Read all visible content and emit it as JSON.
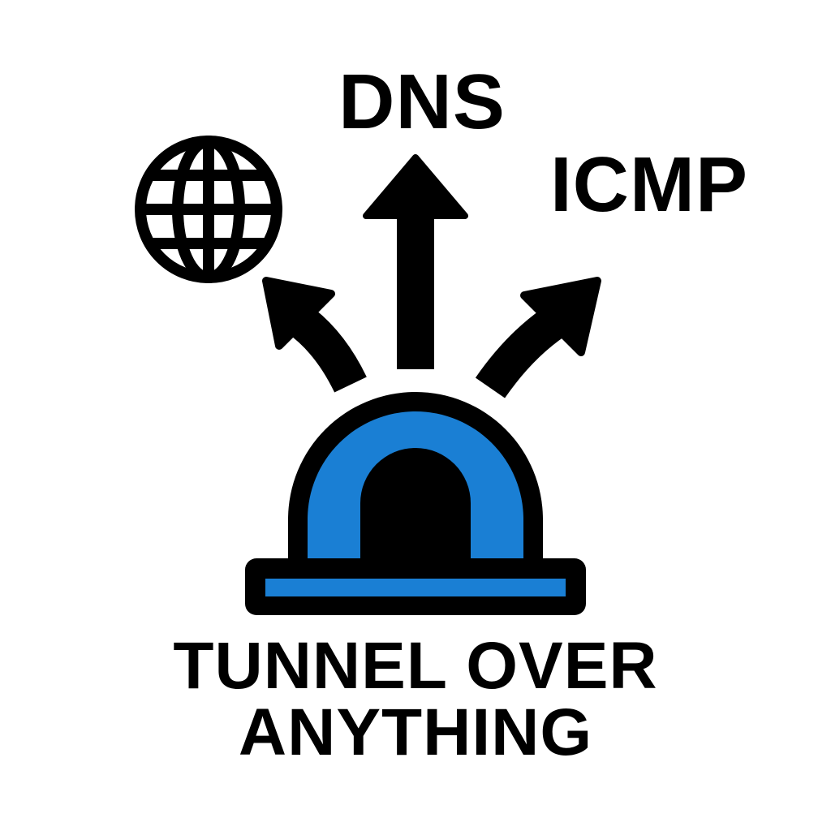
{
  "labels": {
    "top": "DNS",
    "right": "ICMP"
  },
  "caption": {
    "line1": "TUNNEL OVER",
    "line2": "ANYTHING"
  },
  "icons": {
    "globe": "globe-icon",
    "tunnel": "tunnel-icon",
    "arrows": [
      "arrow-up-left-icon",
      "arrow-up-icon",
      "arrow-up-right-icon"
    ]
  },
  "colors": {
    "accent": "#1a7fd4",
    "ink": "#000000",
    "background": "#ffffff"
  }
}
